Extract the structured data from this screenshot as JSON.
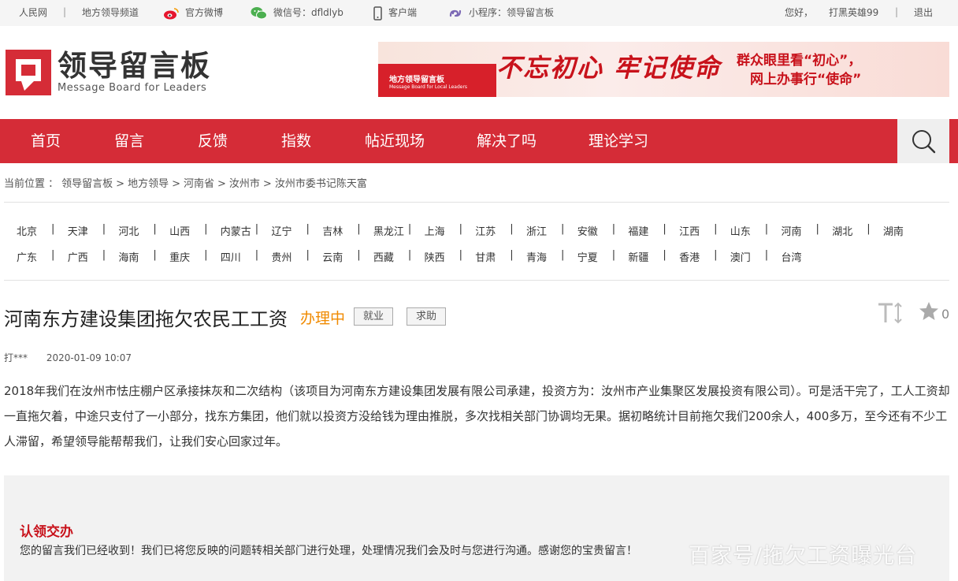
{
  "topbar": {
    "people_daily": "人民网",
    "local_channel": "地方领导频道",
    "weibo": "官方微博",
    "wechat": "微信号：dfldlyb",
    "client": "客户端",
    "miniprogram": "小程序：领导留言板",
    "greeting": "您好，",
    "username": "打黑英雄99",
    "logout": "退出"
  },
  "logo": {
    "cn": "领导留言板",
    "en": "Message Board for Leaders"
  },
  "banner": {
    "logo_cn": "地方领导留言板",
    "logo_en": "Message Board for Local Leaders",
    "slogan_main": "不忘初心 牢记使命",
    "slogan_line1": "群众眼里看“初心”，",
    "slogan_line2": "网上办事行“使命”"
  },
  "nav": {
    "items": [
      "首页",
      "留言",
      "反馈",
      "指数",
      "帖近现场",
      "解决了吗",
      "理论学习"
    ]
  },
  "breadcrumb": {
    "label": "当前位置 ：",
    "items": [
      "领导留言板",
      "地方领导",
      "河南省",
      "汝州市",
      "汝州市委书记陈天富"
    ],
    "separator": ">"
  },
  "regions": {
    "row1": [
      "北京",
      "天津",
      "河北",
      "山西",
      "内蒙古",
      "辽宁",
      "吉林",
      "黑龙江",
      "上海",
      "江苏",
      "浙江",
      "安徽",
      "福建",
      "江西",
      "山东",
      "河南",
      "湖北",
      "湖南"
    ],
    "row2": [
      "广东",
      "广西",
      "海南",
      "重庆",
      "四川",
      "贵州",
      "云南",
      "西藏",
      "陕西",
      "甘肃",
      "青海",
      "宁夏",
      "新疆",
      "香港",
      "澳门",
      "台湾"
    ],
    "separator": "|"
  },
  "article": {
    "title": "河南东方建设集团拖欠农民工工资",
    "status": "办理中",
    "tags": [
      "就业",
      "求助"
    ],
    "favorite_count": "0",
    "author": "打***",
    "datetime": "2020-01-09 10:07",
    "body": "2018年我们在汝州市怯庄棚户区承接抹灰和二次结构（该项目为河南东方建设集团发展有限公司承建，投资方为：汝州市产业集聚区发展投资有限公司）。可是活干完了，工人工资却一直拖欠着，中途只支付了一小部分，找东方集团，他们就以投资方没给钱为理由推脱，多次找相关部门协调均无果。据初略统计目前拖欠我们200余人，400多万，至今还有不少工人滞留，希望领导能帮帮我们，让我们安心回家过年。"
  },
  "reply": {
    "title": "认领交办",
    "text": "您的留言我们已经收到！我们已将您反映的问题转相关部门进行处理，处理情况我们会及时与您进行沟通。感谢您的宝贵留言！"
  },
  "watermark": "百家号/拖欠工资曝光台",
  "colors": {
    "brand_red": "#d52c37",
    "status_orange": "#f08a00",
    "reply_title_red": "#c8121b"
  }
}
